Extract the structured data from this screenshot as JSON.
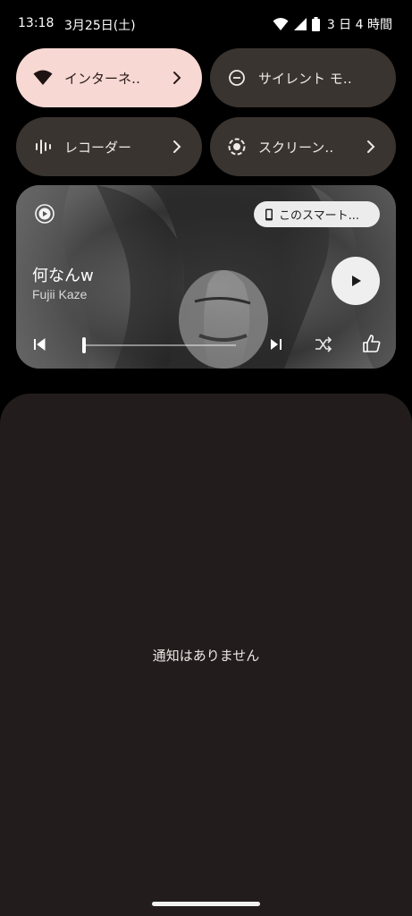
{
  "status_bar": {
    "time": "13:18",
    "date": "3月25日(土)",
    "battery_text": "3 日 4 時間",
    "icons": [
      "wifi-icon",
      "cell-signal-icon",
      "battery-icon"
    ]
  },
  "quick_settings": {
    "tiles": [
      {
        "label": "インターネ‥",
        "icon": "wifi-icon",
        "active": true,
        "has_chevron": true
      },
      {
        "label": "サイレント モ‥",
        "icon": "do-not-disturb-icon",
        "active": false,
        "has_chevron": false
      },
      {
        "label": "レコーダー",
        "icon": "recorder-icon",
        "active": false,
        "has_chevron": true
      },
      {
        "label": "スクリーン‥",
        "icon": "screen-record-icon",
        "active": false,
        "has_chevron": true
      }
    ]
  },
  "media": {
    "device_label": "このスマート...",
    "title": "何なんw",
    "artist": "Fujii Kaze",
    "progress": 0.01
  },
  "notifications": {
    "empty_text": "通知はありません"
  },
  "colors": {
    "tile_active": "#f7d8d3",
    "tile_inactive": "#3a3430",
    "panel_bg": "#221d1c"
  }
}
